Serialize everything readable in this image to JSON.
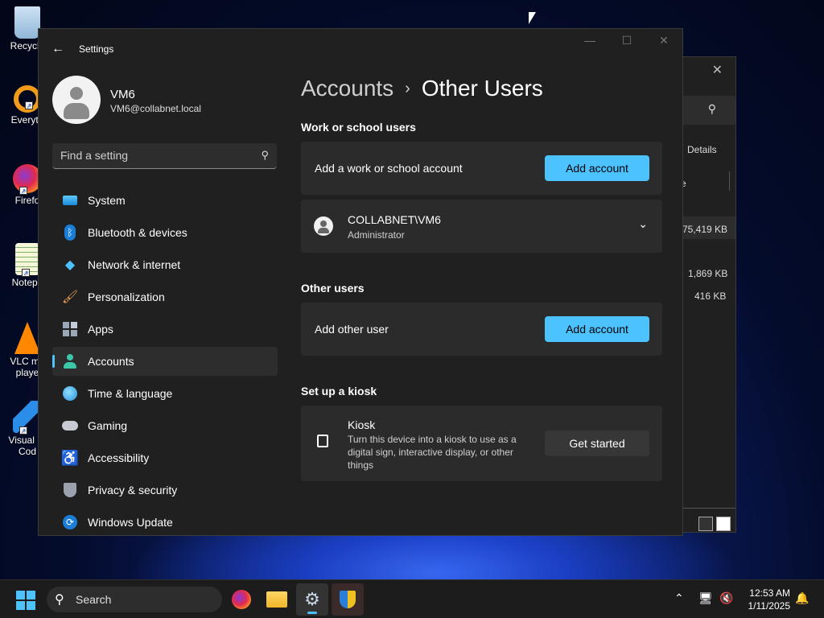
{
  "desktop": {
    "icons": [
      {
        "label": "Recycle",
        "name": "recycle-bin"
      },
      {
        "label": "Everyth",
        "name": "everything"
      },
      {
        "label": "Firefo",
        "name": "firefox"
      },
      {
        "label": "Notepa",
        "name": "notepad"
      },
      {
        "label": "VLC me",
        "label2": "playe",
        "name": "vlc"
      },
      {
        "label": "Visual St",
        "label2": "Cod",
        "name": "vscode"
      }
    ]
  },
  "background_window": {
    "close_glyph": "✕",
    "details_label": "Details",
    "partial_header": "e",
    "memory_values": [
      "75,419 KB",
      "1,869 KB",
      "416 KB"
    ]
  },
  "settings": {
    "window_title": "Settings",
    "profile": {
      "name": "VM6",
      "email": "VM6@collabnet.local"
    },
    "search": {
      "placeholder": "Find a setting"
    },
    "nav": [
      {
        "label": "System",
        "icon": "system-icon",
        "active": false
      },
      {
        "label": "Bluetooth & devices",
        "icon": "bluetooth-icon",
        "active": false
      },
      {
        "label": "Network & internet",
        "icon": "wifi-icon",
        "active": false
      },
      {
        "label": "Personalization",
        "icon": "brush-icon",
        "active": false
      },
      {
        "label": "Apps",
        "icon": "apps-icon",
        "active": false
      },
      {
        "label": "Accounts",
        "icon": "accounts-icon",
        "active": true
      },
      {
        "label": "Time & language",
        "icon": "globe-clock-icon",
        "active": false
      },
      {
        "label": "Gaming",
        "icon": "gamepad-icon",
        "active": false
      },
      {
        "label": "Accessibility",
        "icon": "accessibility-icon",
        "active": false
      },
      {
        "label": "Privacy & security",
        "icon": "shield-icon",
        "active": false
      },
      {
        "label": "Windows Update",
        "icon": "update-icon",
        "active": false
      }
    ],
    "breadcrumb": {
      "parent": "Accounts",
      "separator": "›",
      "current": "Other Users"
    },
    "work_school": {
      "title": "Work or school users",
      "add_label": "Add a work or school account",
      "add_button": "Add account",
      "user": {
        "name": "COLLABNET\\VM6",
        "role": "Administrator"
      }
    },
    "other_users": {
      "title": "Other users",
      "add_label": "Add other user",
      "add_button": "Add account"
    },
    "kiosk": {
      "section_title": "Set up a kiosk",
      "title": "Kiosk",
      "description": "Turn this device into a kiosk to use as a digital sign, interactive display, or other things",
      "button": "Get started"
    }
  },
  "taskbar": {
    "search_label": "Search",
    "apps": [
      "firefox",
      "file-explorer",
      "settings",
      "security"
    ],
    "time": "12:53 AM",
    "date": "1/11/2025"
  },
  "colors": {
    "accent": "#4cc2ff",
    "window_bg": "#202020",
    "card_bg": "#2b2b2b"
  }
}
